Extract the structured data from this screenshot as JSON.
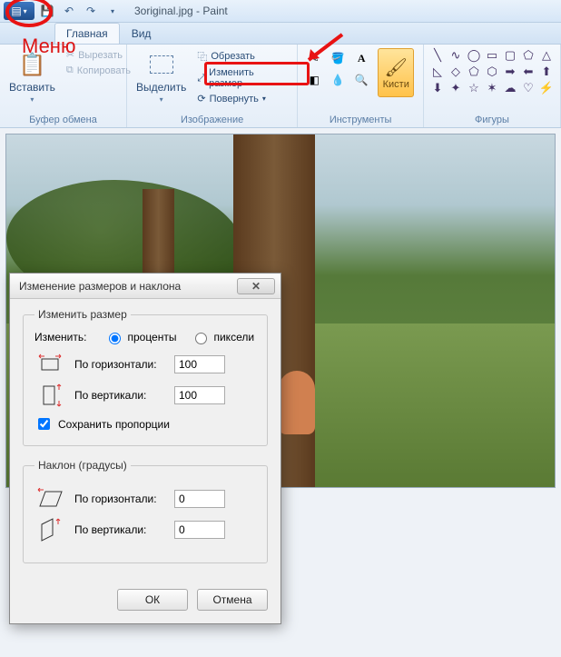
{
  "app": {
    "title_file": "3original.jpg",
    "title_app": "Paint"
  },
  "qat": {
    "save": "💾",
    "undo": "↶",
    "redo": "↷"
  },
  "tabs": {
    "home": "Главная",
    "view": "Вид"
  },
  "ribbon": {
    "clipboard": {
      "label": "Буфер обмена",
      "paste": "Вставить",
      "cut": "Вырезать",
      "copy": "Копировать"
    },
    "image": {
      "label": "Изображение",
      "select": "Выделить",
      "crop": "Обрезать",
      "resize": "Изменить размер",
      "rotate": "Повернуть"
    },
    "tools": {
      "label": "Инструменты",
      "brushes": "Кисти"
    },
    "shapes": {
      "label": "Фигуры"
    }
  },
  "dialog": {
    "title": "Изменение размеров и наклона",
    "resize_group": "Изменить размер",
    "change_label": "Изменить:",
    "percent": "проценты",
    "pixels": "пиксели",
    "horizontal": "По горизонтали:",
    "vertical": "По вертикали:",
    "h_value": "100",
    "v_value": "100",
    "keep_aspect": "Сохранить пропорции",
    "skew_group": "Наклон (градусы)",
    "skew_h_value": "0",
    "skew_v_value": "0",
    "ok": "ОК",
    "cancel": "Отмена"
  },
  "annotation": {
    "menu_label": "Меню"
  }
}
